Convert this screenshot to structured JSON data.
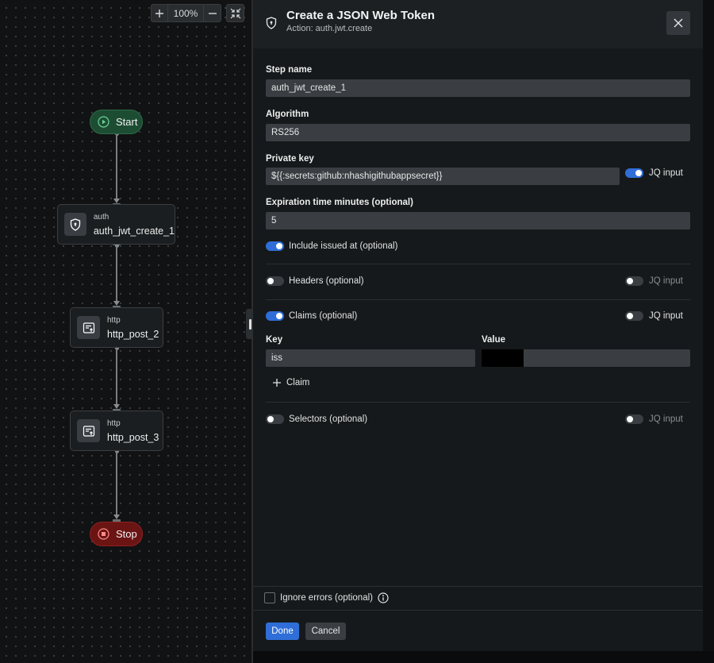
{
  "canvas": {
    "zoom": {
      "plus_icon": "plus-icon",
      "value": "100%",
      "minus_icon": "minus-icon",
      "fit_icon": "collapse-arrows-icon"
    },
    "nodes": {
      "start": {
        "label": "Start",
        "icon": "play-circle-icon",
        "color": "#1c4d33"
      },
      "auth_node": {
        "type": "auth",
        "name": "auth_jwt_create_1",
        "icon": "shield-icon"
      },
      "http_node_1": {
        "type": "http",
        "name": "http_post_2",
        "icon": "http-request-icon"
      },
      "http_node_2": {
        "type": "http",
        "name": "http_post_3",
        "icon": "http-request-icon"
      },
      "stop": {
        "label": "Stop",
        "icon": "stop-circle-icon",
        "color": "#6b1414"
      }
    }
  },
  "panel": {
    "header": {
      "icon": "shield-icon",
      "title": "Create a JSON Web Token",
      "subtitle": "Action: auth.jwt.create",
      "close_icon": "close-icon"
    },
    "fields": {
      "step_name": {
        "label": "Step name",
        "value": "auth_jwt_create_1"
      },
      "algorithm": {
        "label": "Algorithm",
        "value": "RS256"
      },
      "private_key": {
        "label": "Private key",
        "value": "${{:secrets:github:nhashigithubappsecret}}",
        "jq_label": "JQ input",
        "jq_on": true
      },
      "expiration": {
        "label": "Expiration time minutes (optional)",
        "value": "5"
      },
      "include_issued_at": {
        "label": "Include issued at (optional)",
        "on": true
      }
    },
    "sections": {
      "headers": {
        "label": "Headers (optional)",
        "on": false,
        "jq_label": "JQ input",
        "jq_on": false
      },
      "claims": {
        "label": "Claims (optional)",
        "on": true,
        "jq_label": "JQ input",
        "jq_on": false,
        "key_header": "Key",
        "value_header": "Value",
        "rows": [
          {
            "key": "iss",
            "value": ""
          }
        ],
        "add_label": "Claim"
      },
      "selectors": {
        "label": "Selectors (optional)",
        "on": false,
        "jq_label": "JQ input",
        "jq_on": false
      }
    },
    "footer": {
      "ignore_errors_label": "Ignore errors (optional)",
      "ignore_errors_checked": false,
      "info_icon": "info-icon",
      "done_label": "Done",
      "cancel_label": "Cancel"
    },
    "accent": "#2f6ed8"
  }
}
